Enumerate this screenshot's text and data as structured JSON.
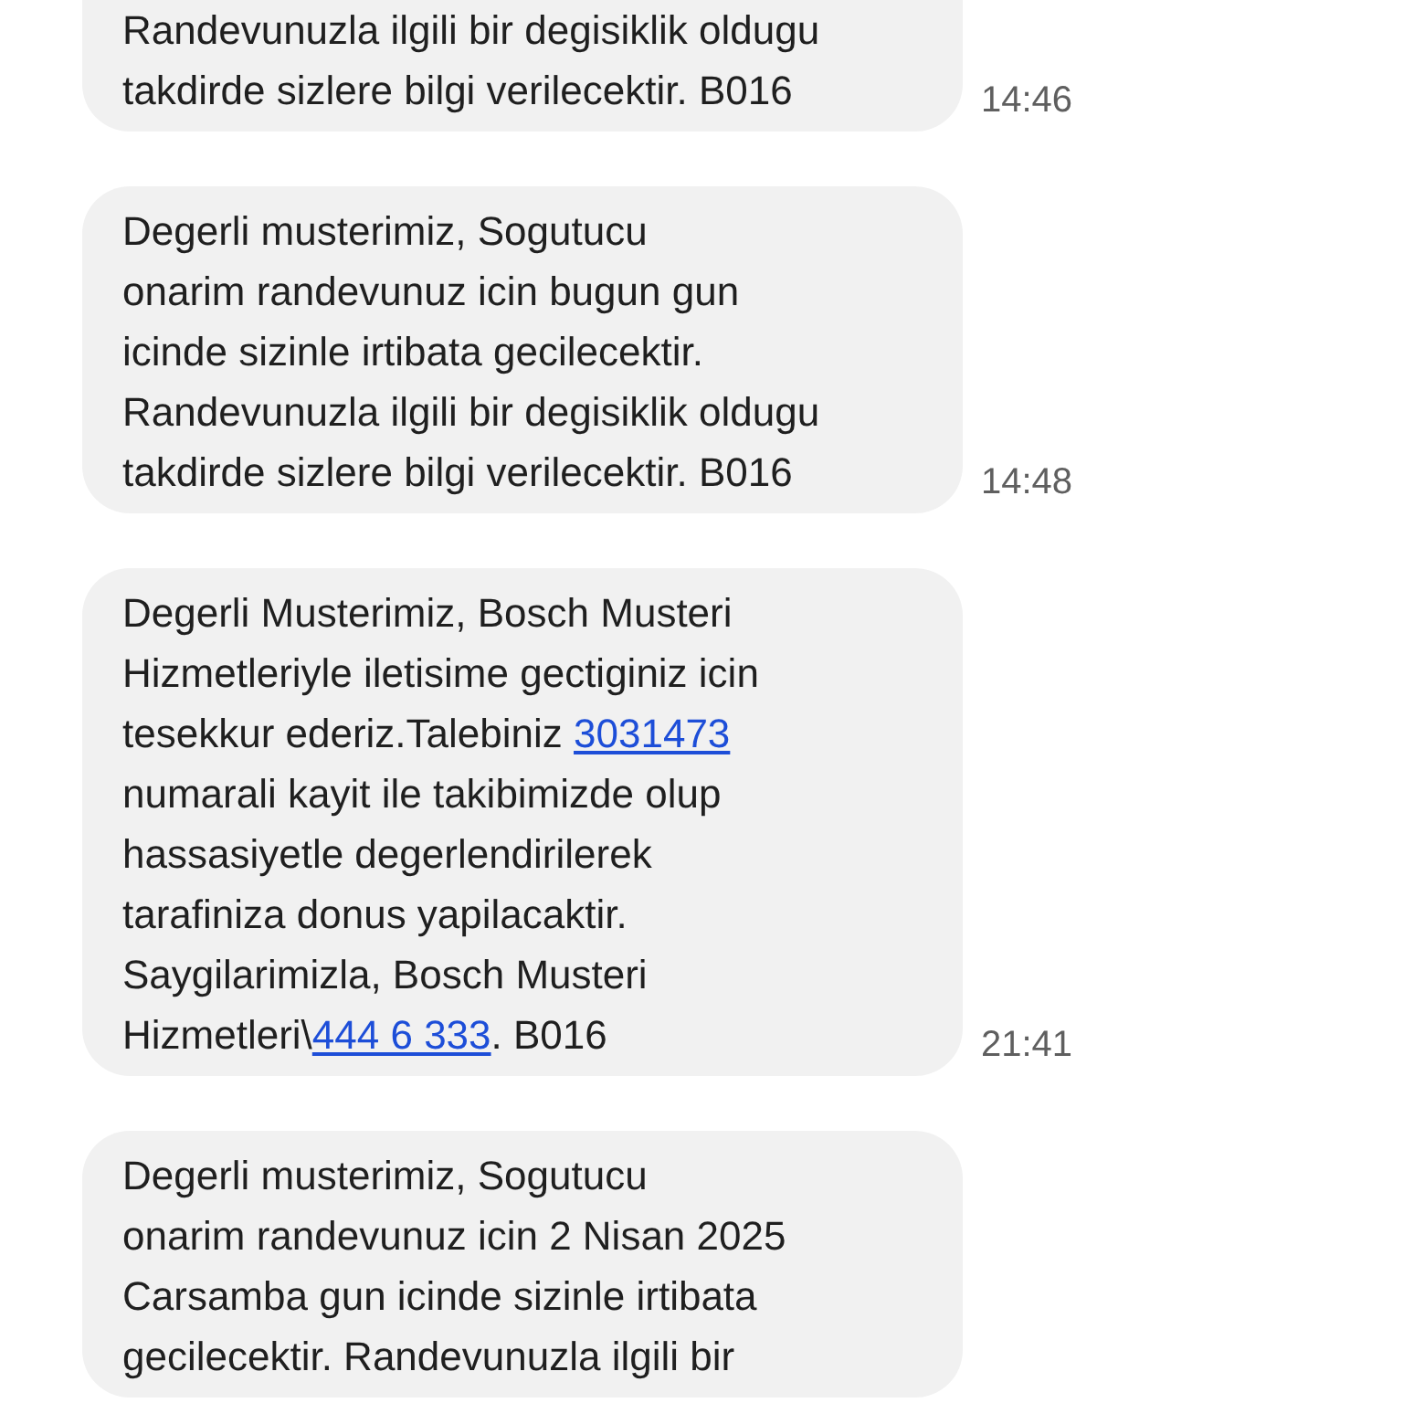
{
  "messages": [
    {
      "time": "14:46",
      "lines": [
        [
          {
            "kind": "text",
            "text": "Randevunuzla ilgili bir degisiklik oldugu"
          }
        ],
        [
          {
            "kind": "text",
            "text": "takdirde sizlere bilgi verilecektir. B016"
          }
        ]
      ]
    },
    {
      "time": "14:48",
      "lines": [
        [
          {
            "kind": "text",
            "text": "Degerli musterimiz, Sogutucu"
          }
        ],
        [
          {
            "kind": "text",
            "text": "onarim randevunuz icin bugun gun"
          }
        ],
        [
          {
            "kind": "text",
            "text": "icinde sizinle irtibata gecilecektir."
          }
        ],
        [
          {
            "kind": "text",
            "text": "Randevunuzla ilgili bir degisiklik oldugu"
          }
        ],
        [
          {
            "kind": "text",
            "text": "takdirde sizlere bilgi verilecektir. B016"
          }
        ]
      ]
    },
    {
      "time": "21:41",
      "lines": [
        [
          {
            "kind": "text",
            "text": "Degerli Musterimiz, Bosch Musteri"
          }
        ],
        [
          {
            "kind": "text",
            "text": "Hizmetleriyle iletisime gectiginiz icin"
          }
        ],
        [
          {
            "kind": "text",
            "text": "tesekkur ederiz.Talebiniz "
          },
          {
            "kind": "link",
            "text": "3031473"
          }
        ],
        [
          {
            "kind": "text",
            "text": "numarali kayit ile takibimizde olup"
          }
        ],
        [
          {
            "kind": "text",
            "text": "hassasiyetle degerlendirilerek"
          }
        ],
        [
          {
            "kind": "text",
            "text": "tarafiniza donus yapilacaktir."
          }
        ],
        [
          {
            "kind": "text",
            "text": "Saygilarimizla, Bosch Musteri"
          }
        ],
        [
          {
            "kind": "text",
            "text": "Hizmetleri\\"
          },
          {
            "kind": "link",
            "text": "444 6 333"
          },
          {
            "kind": "text",
            "text": ". B016"
          }
        ]
      ]
    },
    {
      "lines": [
        [
          {
            "kind": "text",
            "text": "Degerli musterimiz, Sogutucu"
          }
        ],
        [
          {
            "kind": "text",
            "text": "onarim randevunuz icin 2 Nisan 2025"
          }
        ],
        [
          {
            "kind": "text",
            "text": "Carsamba gun icinde sizinle irtibata"
          }
        ],
        [
          {
            "kind": "text",
            "text": "gecilecektir. Randevunuzla ilgili bir"
          }
        ]
      ]
    }
  ]
}
